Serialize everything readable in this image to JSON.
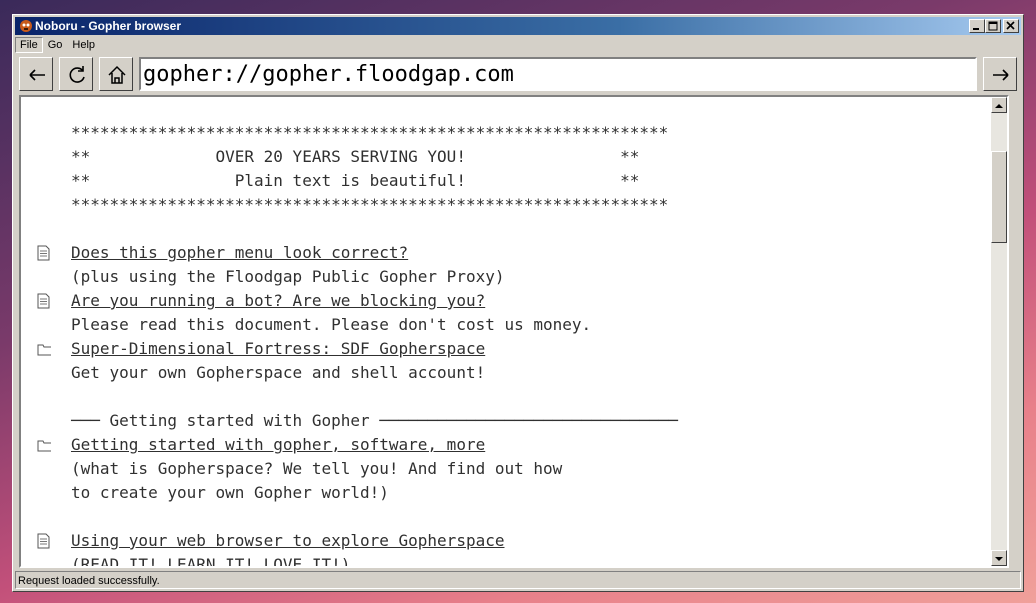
{
  "window": {
    "title": "Noboru - Gopher browser"
  },
  "menu": {
    "file": "File",
    "go": "Go",
    "help": "Help"
  },
  "toolbar": {
    "back_icon": "arrow-left-icon",
    "reload_icon": "reload-icon",
    "home_icon": "home-icon",
    "go_icon": "arrow-right-icon",
    "address": "gopher://gopher.floodgap.com"
  },
  "content": {
    "lines": [
      {
        "kind": "info",
        "text": "**************************************************************"
      },
      {
        "kind": "info",
        "text": "**             OVER 20 YEARS SERVING YOU!                **"
      },
      {
        "kind": "info",
        "text": "**               Plain text is beautiful!                **"
      },
      {
        "kind": "info",
        "text": "**************************************************************"
      },
      {
        "kind": "info",
        "text": ""
      },
      {
        "kind": "document",
        "text": "Does this gopher menu look correct?"
      },
      {
        "kind": "info",
        "text": "(plus using the Floodgap Public Gopher Proxy)"
      },
      {
        "kind": "document",
        "text": "Are you running a bot? Are we blocking you?"
      },
      {
        "kind": "info",
        "text": "Please read this document. Please don't cost us money."
      },
      {
        "kind": "folder",
        "text": "Super-Dimensional Fortress: SDF Gopherspace"
      },
      {
        "kind": "info",
        "text": "Get your own Gopherspace and shell account!"
      },
      {
        "kind": "info",
        "text": ""
      },
      {
        "kind": "info",
        "text": "─── Getting started with Gopher ───────────────────────────────"
      },
      {
        "kind": "folder",
        "text": "Getting started with gopher, software, more"
      },
      {
        "kind": "info",
        "text": "(what is Gopherspace? We tell you! And find out how"
      },
      {
        "kind": "info",
        "text": "to create your own Gopher world!)"
      },
      {
        "kind": "info",
        "text": ""
      },
      {
        "kind": "document",
        "text": "Using your web browser to explore Gopherspace"
      },
      {
        "kind": "info",
        "text": "(READ IT! LEARN IT! LOVE IT!)"
      }
    ]
  },
  "status": {
    "text": "Request loaded successfully."
  }
}
